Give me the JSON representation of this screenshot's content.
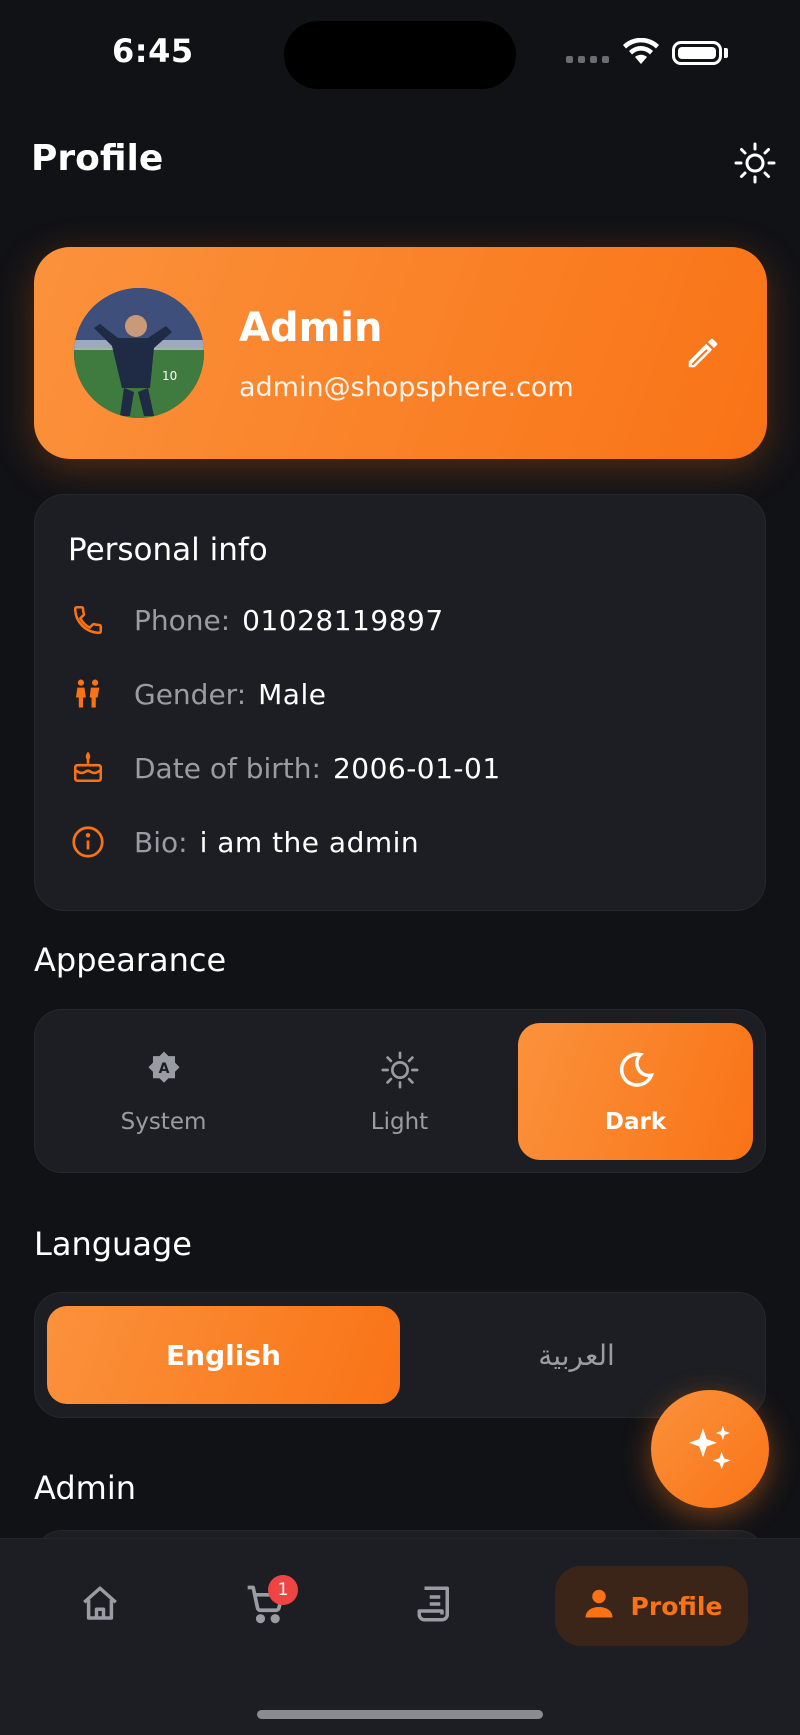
{
  "status_bar": {
    "time": "6:45"
  },
  "header": {
    "title": "Profile",
    "theme_icon": "sun-icon"
  },
  "profile": {
    "name": "Admin",
    "email": "admin@shopsphere.com"
  },
  "personal_info": {
    "title": "Personal info",
    "rows": [
      {
        "icon": "phone-icon",
        "label": "Phone:",
        "value": "01028119897"
      },
      {
        "icon": "gender-icon",
        "label": "Gender:",
        "value": "Male"
      },
      {
        "icon": "cake-icon",
        "label": "Date of birth:",
        "value": "2006-01-01"
      },
      {
        "icon": "info-icon",
        "label": "Bio:",
        "value": "i am the admin"
      }
    ]
  },
  "appearance": {
    "title": "Appearance",
    "options": [
      {
        "label": "System",
        "icon": "auto-brightness-icon",
        "active": false
      },
      {
        "label": "Light",
        "icon": "sun-icon",
        "active": false
      },
      {
        "label": "Dark",
        "icon": "moon-icon",
        "active": true
      }
    ]
  },
  "language": {
    "title": "Language",
    "options": [
      {
        "label": "English",
        "active": true
      },
      {
        "label": "العربية",
        "active": false
      }
    ]
  },
  "admin_section": {
    "title": "Admin"
  },
  "bottom_nav": {
    "items": [
      {
        "icon": "home-icon"
      },
      {
        "icon": "cart-icon",
        "badge": "1"
      },
      {
        "icon": "orders-icon"
      },
      {
        "icon": "person-icon",
        "label": "Profile",
        "active": true
      }
    ]
  },
  "colors": {
    "accent": "#f97316",
    "background": "#111216",
    "card": "#1c1e23",
    "badge": "#ef4444"
  }
}
